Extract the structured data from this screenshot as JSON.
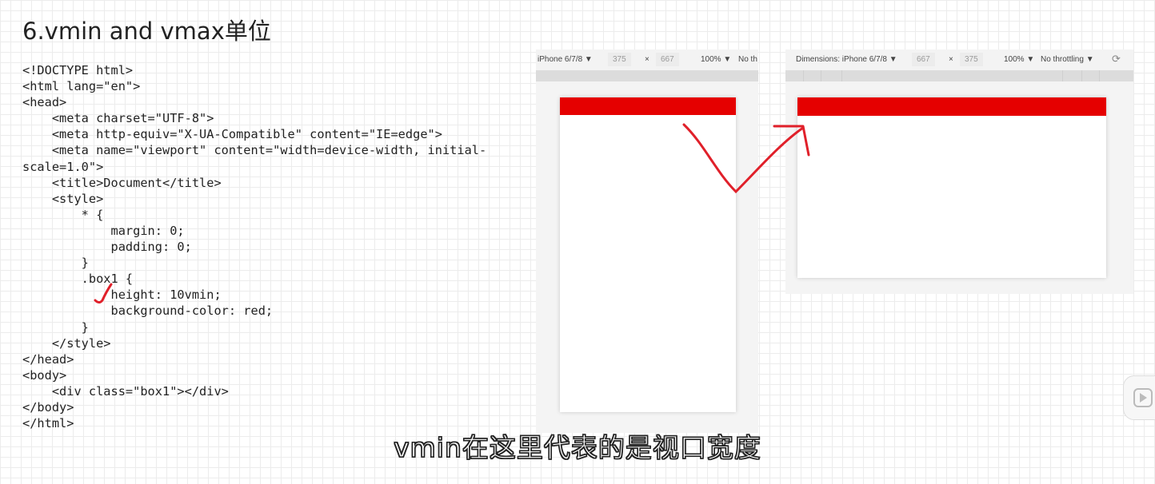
{
  "slide": {
    "title": "6.vmin and vmax单位",
    "subtitle": "vmin在这里代表的是视口宽度"
  },
  "code_lines": [
    "<!DOCTYPE html>",
    "<html lang=\"en\">",
    "<head>",
    "    <meta charset=\"UTF-8\">",
    "    <meta http-equiv=\"X-UA-Compatible\" content=\"IE=edge\">",
    "    <meta name=\"viewport\" content=\"width=device-width, initial-",
    "scale=1.0\">",
    "    <title>Document</title>",
    "    <style>",
    "        * {",
    "            margin: 0;",
    "            padding: 0;",
    "        }",
    "        .box1 {",
    "            height: 10vmin;",
    "            background-color: red;",
    "        }",
    "    </style>",
    "</head>",
    "<body>",
    "    <div class=\"box1\"></div>",
    "</body>",
    "</html>"
  ],
  "left_device": {
    "device": "iPhone 6/7/8 ▼",
    "width": "375",
    "times": "×",
    "height": "667",
    "zoom": "100% ▼",
    "throttle": "No th"
  },
  "right_device": {
    "device": "Dimensions: iPhone 6/7/8 ▼",
    "width": "667",
    "times": "×",
    "height": "375",
    "zoom": "100% ▼",
    "throttle": "No throttling ▼",
    "rotate_icon": "rotate-icon"
  },
  "colors": {
    "box": "#e50000",
    "annotation": "#e0202a"
  }
}
